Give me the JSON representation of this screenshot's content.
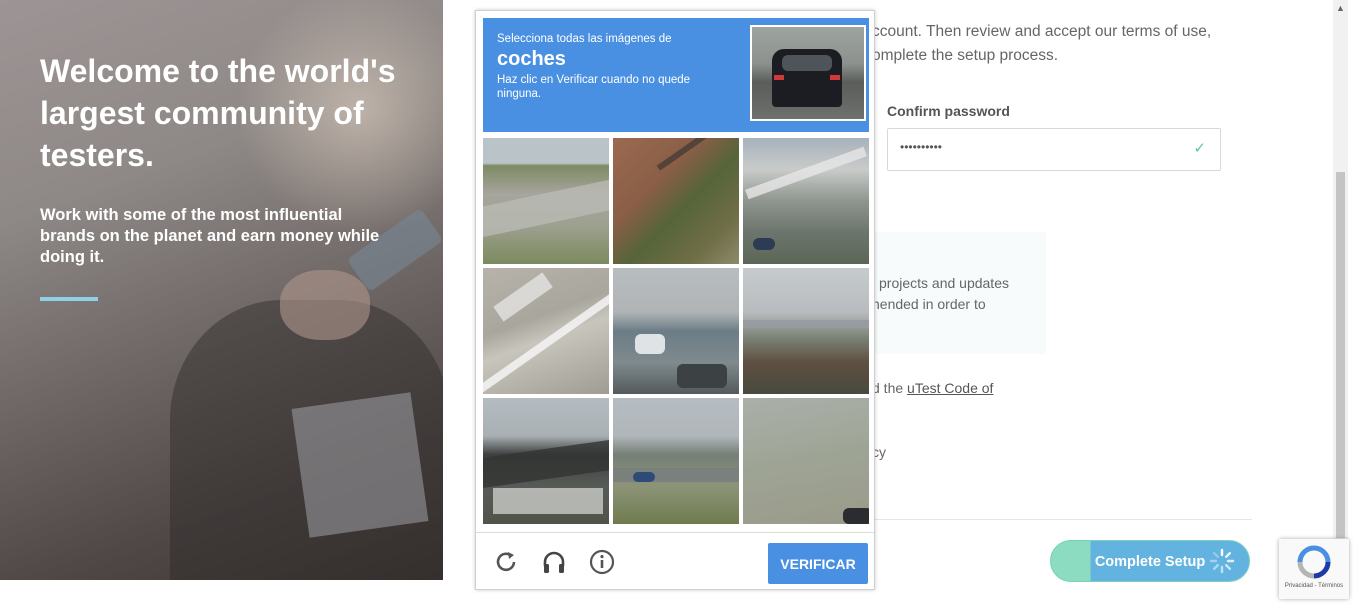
{
  "hero": {
    "title": "Welcome to the world's largest community of testers.",
    "subtitle": "Work with some of the most influential brands on the planet and earn money while doing it.",
    "accent_color": "#8fd0e6"
  },
  "form": {
    "intro_line1": "ccount. Then review and accept our terms of use,",
    "intro_line2": "omplete the setup process.",
    "confirm_password_label": "Confirm password",
    "confirm_password_value": "••••••••••",
    "info_line1": "projects and updates",
    "info_line2": "nended in order to",
    "code_prefix": "d the ",
    "code_link": "uTest Code of",
    "privacy_fragment": "cy",
    "complete_button": "Complete Setup"
  },
  "captcha": {
    "instruction_line1": "Selecciona todas las imágenes de",
    "target_word": "coches",
    "instruction_line2": "Haz clic en Verificar cuando no quede ninguna.",
    "verify_button": "VERIFICAR",
    "accent_color": "#4a90e2",
    "footer_icons": [
      "reload-icon",
      "headphones-icon",
      "info-icon"
    ]
  },
  "recaptcha_badge": {
    "terms": "Privacidad - Términos"
  }
}
